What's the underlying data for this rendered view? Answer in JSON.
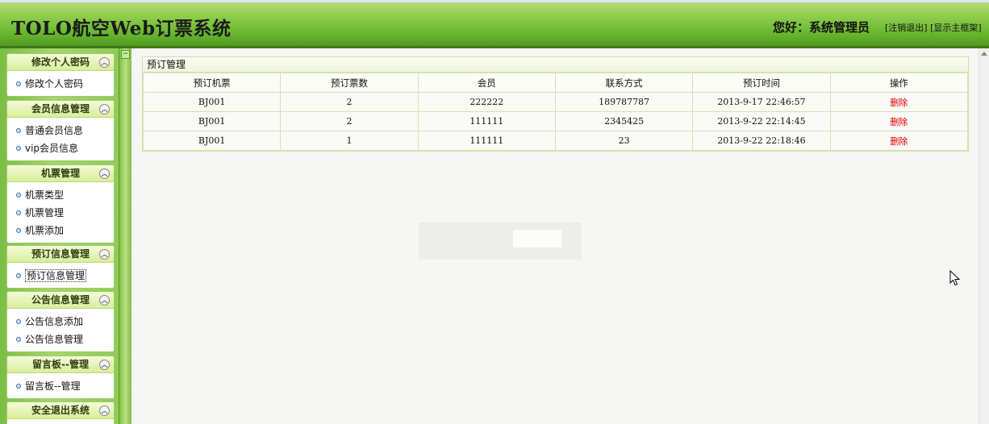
{
  "header": {
    "title": "TOLO航空Web订票系统",
    "greeting": "您好：系统管理员",
    "logout_label": "[注销退出]",
    "frame_label": "[显示主框架]"
  },
  "sidebar": {
    "groups": [
      {
        "title": "修改个人密码",
        "items": [
          "修改个人密码"
        ]
      },
      {
        "title": "会员信息管理",
        "items": [
          "普通会员信息",
          "vip会员信息"
        ]
      },
      {
        "title": "机票管理",
        "items": [
          "机票类型",
          "机票管理",
          "机票添加"
        ]
      },
      {
        "title": "预订信息管理",
        "items": [
          "预订信息管理"
        ]
      },
      {
        "title": "公告信息管理",
        "items": [
          "公告信息添加",
          "公告信息管理"
        ]
      },
      {
        "title": "留言板--管理",
        "items": [
          "留言板--管理"
        ]
      },
      {
        "title": "安全退出系统",
        "items": []
      }
    ],
    "active_item": "预订信息管理"
  },
  "panel": {
    "title": "预订管理",
    "columns": [
      "预订机票",
      "预订票数",
      "会员",
      "联系方式",
      "预订时间",
      "操作"
    ],
    "rows": [
      [
        "BJ001",
        "2",
        "222222",
        "189787787",
        "2013-9-17 22:46:57",
        "删除"
      ],
      [
        "BJ001",
        "2",
        "111111",
        "2345425",
        "2013-9-22 22:14:45",
        "删除"
      ],
      [
        "BJ001",
        "1",
        "111111",
        "23",
        "2013-9-22 22:18:46",
        "删除"
      ]
    ]
  },
  "colors": {
    "header_green": "#66b52d",
    "delete_red": "#e00000"
  }
}
